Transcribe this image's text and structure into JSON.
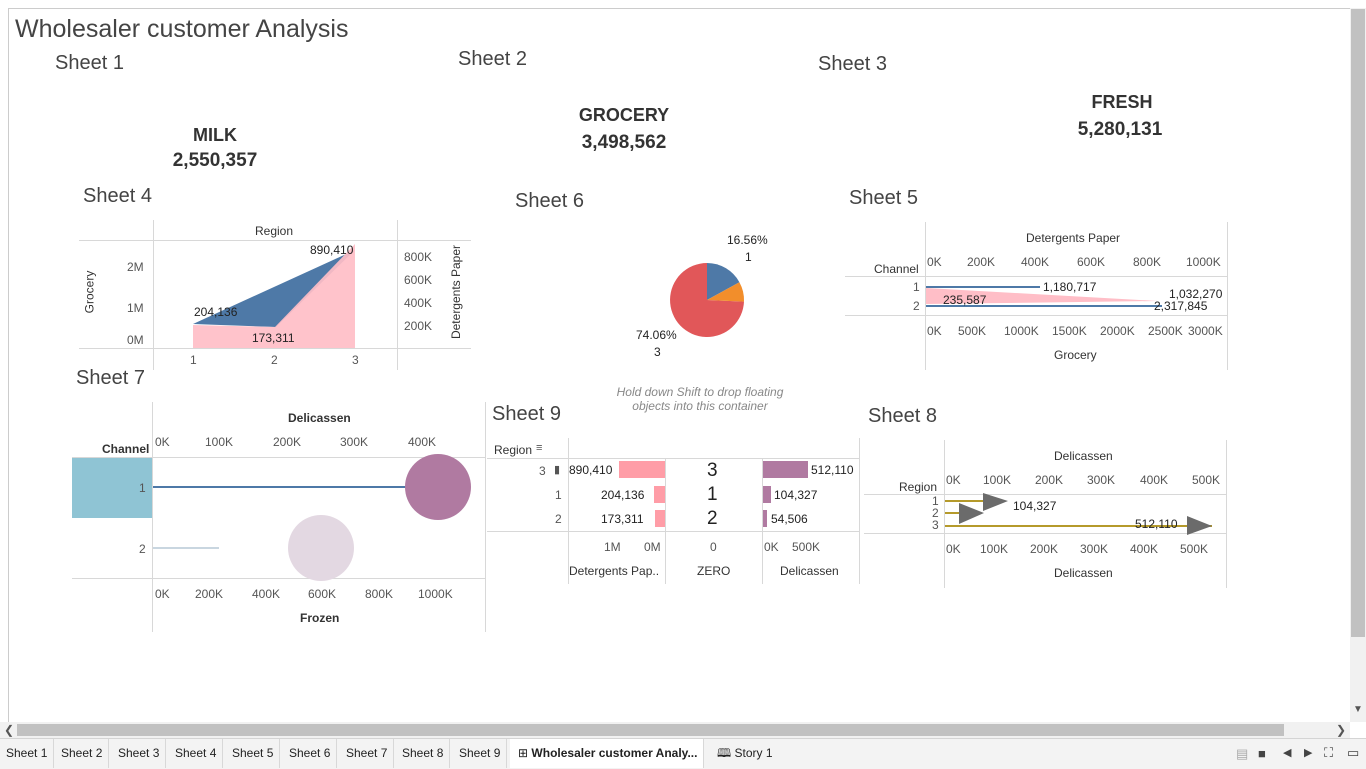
{
  "dashboard": {
    "title": "Wholesaler customer Analysis",
    "drop_hint": [
      "Hold down Shift to drop floating",
      "objects into this container"
    ]
  },
  "sheets": {
    "s1": "Sheet 1",
    "s2": "Sheet 2",
    "s3": "Sheet 3",
    "s4": "Sheet 4",
    "s5": "Sheet 5",
    "s6": "Sheet 6",
    "s7": "Sheet 7",
    "s8": "Sheet 8",
    "s9": "Sheet 9"
  },
  "kpis": [
    {
      "label": "MILK",
      "value": "2,550,357"
    },
    {
      "label": "GROCERY",
      "value": "3,498,562"
    },
    {
      "label": "FRESH",
      "value": "5,280,131"
    }
  ],
  "sheet4": {
    "header": "Region",
    "y_left_label": "Grocery",
    "y_right_label": "Detergents Paper",
    "y_left_ticks": [
      "2M",
      "1M",
      "0M"
    ],
    "y_right_ticks": [
      "800K",
      "600K",
      "400K",
      "200K"
    ],
    "x_ticks": [
      "1",
      "2",
      "3"
    ],
    "labels": [
      "890,410",
      "204,136",
      "173,311"
    ]
  },
  "sheet5": {
    "header": "Detergents Paper",
    "row_header": "Channel",
    "top_ticks": [
      "0K",
      "200K",
      "400K",
      "600K",
      "800K",
      "1000K"
    ],
    "bottom_ticks": [
      "0K",
      "500K",
      "1000K",
      "1500K",
      "2000K",
      "2500K",
      "3000K"
    ],
    "rows": [
      "1",
      "2"
    ],
    "bottom_label": "Grocery",
    "labels": [
      "1,180,717",
      "235,587",
      "1,032,270",
      "2,317,845"
    ]
  },
  "sheet6": {
    "labels": [
      "16.56%",
      "1",
      "74.06%",
      "3"
    ]
  },
  "sheet7": {
    "header": "Delicassen",
    "row_header": "Channel",
    "top_ticks": [
      "0K",
      "100K",
      "200K",
      "300K",
      "400K"
    ],
    "bottom_ticks": [
      "0K",
      "200K",
      "400K",
      "600K",
      "800K",
      "1000K"
    ],
    "rows": [
      "1",
      "2"
    ],
    "bottom_label": "Frozen"
  },
  "sheet9": {
    "row_header": "Region",
    "rows": [
      "3",
      "1",
      "2"
    ],
    "det_values": [
      "890,410",
      "204,136",
      "173,311"
    ],
    "zero_values": [
      "3",
      "1",
      "2"
    ],
    "del_values": [
      "512,110",
      "104,327",
      "54,506"
    ],
    "det_ticks": [
      "1M",
      "0M"
    ],
    "zero_ticks": [
      "0"
    ],
    "del_ticks": [
      "0K",
      "500K"
    ],
    "col_labels": [
      "Detergents Pap..",
      "ZERO",
      "Delicassen"
    ]
  },
  "sheet8": {
    "header": "Delicassen",
    "row_header": "Region",
    "top_ticks": [
      "0K",
      "100K",
      "200K",
      "300K",
      "400K",
      "500K"
    ],
    "bottom_ticks": [
      "0K",
      "100K",
      "200K",
      "300K",
      "400K",
      "500K"
    ],
    "rows": [
      "1",
      "2",
      "3"
    ],
    "bottom_label": "Delicassen",
    "labels": [
      "104,327",
      "512,110"
    ]
  },
  "tabs": [
    "Sheet 1",
    "Sheet 2",
    "Sheet 3",
    "Sheet 4",
    "Sheet 5",
    "Sheet 6",
    "Sheet 7",
    "Sheet 8",
    "Sheet 9",
    "Wholesaler customer Analy...",
    "Story 1"
  ],
  "colors": {
    "blue": "#4e79a7",
    "pink": "#ffbec7",
    "orange": "#f28e2b",
    "red": "#e15759",
    "purple": "#b07aa1",
    "teal": "#8fc4d4",
    "gold": "#b59a2b"
  }
}
